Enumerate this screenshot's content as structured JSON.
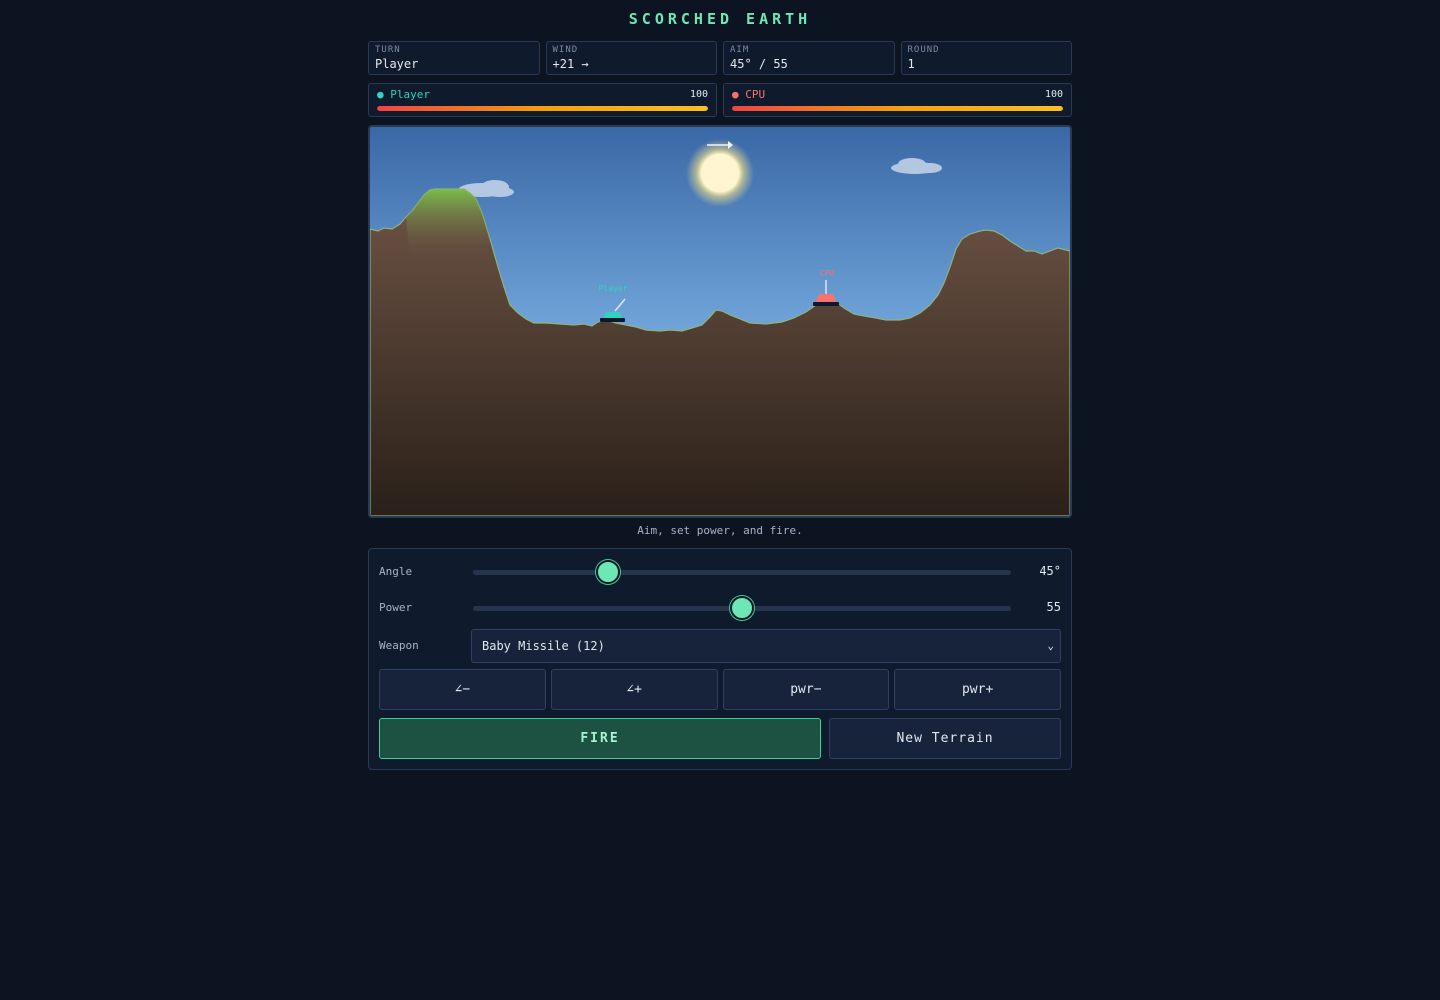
{
  "title": "SCORCHED EARTH",
  "stats": [
    {
      "label": "TURN",
      "value": "Player"
    },
    {
      "label": "WIND",
      "value": "+21 →"
    },
    {
      "label": "AIM",
      "value": "45° / 55"
    },
    {
      "label": "ROUND",
      "value": "1"
    }
  ],
  "players": [
    {
      "name": "● Player",
      "health": "100",
      "health_fraction": 1.0,
      "color": "#2dd4bf"
    },
    {
      "name": "● CPU",
      "health": "100",
      "health_fraction": 1.0,
      "color": "#f87171"
    }
  ],
  "battlefield": {
    "player_tag": "Player",
    "cpu_tag": "CPU",
    "wind_indicator": "arrow-right-icon",
    "sky_top": "#3a6aa8",
    "sky_bottom": "#8ec1ea",
    "ground_color": "#6b5244",
    "grass_color": "#7cc24a",
    "player_color": "#2dd4bf",
    "cpu_color": "#f87171"
  },
  "status_message": "Aim, set power, and fire.",
  "controls": {
    "angle": {
      "label": "Angle",
      "value": 45,
      "display": "45°",
      "min": 0,
      "max": 180
    },
    "power": {
      "label": "Power",
      "value": 55,
      "display": "55",
      "min": 0,
      "max": 110
    },
    "weapon": {
      "label": "Weapon",
      "selected": "Baby Missile (12)"
    },
    "buttons": [
      {
        "label": "∠−"
      },
      {
        "label": "∠+"
      },
      {
        "label": "pwr−"
      },
      {
        "label": "pwr+"
      }
    ],
    "fire_label": "FIRE",
    "new_terrain_label": "New Terrain"
  },
  "accent": "#6ee7b7"
}
